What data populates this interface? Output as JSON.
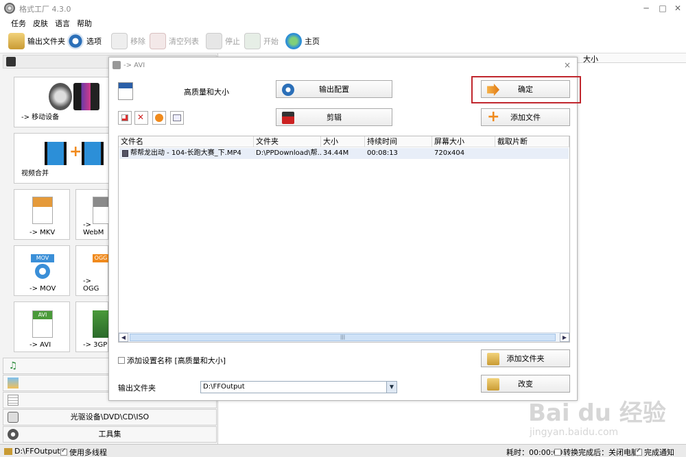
{
  "window": {
    "title": "格式工厂 4.3.0",
    "minimize": "─",
    "maximize": "□",
    "close": "✕"
  },
  "menu": [
    "任务",
    "皮肤",
    "语言",
    "帮助"
  ],
  "toolbar": {
    "output_folder": "输出文件夹",
    "options": "选项",
    "remove": "移除",
    "clear_list": "清空列表",
    "stop": "停止",
    "start": "开始",
    "home": "主页"
  },
  "left_panel": {
    "tiles": {
      "mobile": "-> 移动设备",
      "merge": "视频合并",
      "mkv": "-> MKV",
      "webm": "-> WebM",
      "mov": "-> MOV",
      "ogg": "-> OGG",
      "avi": "-> AVI",
      "3gp": "-> 3GP"
    },
    "icon_badges": {
      "mov": "MOV",
      "ogg": "OGG",
      "avi": "AVI"
    },
    "categories": {
      "disc": "光驱设备\\DVD\\CD\\ISO",
      "tools": "工具集"
    }
  },
  "background_table": {
    "size_header": "大小"
  },
  "dialog": {
    "title": "-> AVI",
    "close": "×",
    "profile_label": "高质量和大小",
    "output_config_button": "输出配置",
    "confirm_button": "确定",
    "edit_button": "剪辑",
    "add_file_button": "添加文件",
    "add_folder_button": "添加文件夹",
    "change_button": "改变",
    "add_setting_name_label": "添加设置名称 [高质量和大小]",
    "output_folder_label": "输出文件夹",
    "output_folder_value": "D:\\FFOutput",
    "columns": [
      "文件名",
      "文件夹",
      "大小",
      "持续时间",
      "屏幕大小",
      "截取片断"
    ],
    "rows": [
      {
        "filename": "帮帮龙出动 - 104-长跑大赛_下.MP4",
        "folder": "D:\\PPDownload\\帮...",
        "size": "34.44M",
        "duration": "00:08:13",
        "screen_size": "720x404",
        "clip": ""
      }
    ],
    "scroll_left": "◀",
    "scroll_right": "▶",
    "scroll_grip": "|||",
    "select_arrow": "▼"
  },
  "statusbar": {
    "folder": "D:\\FFOutput",
    "multithread": "使用多线程",
    "elapsed": "耗时：00:00:00",
    "after_convert": "转换完成后：关闭电脑",
    "notify": "完成通知"
  },
  "watermark": {
    "logo": "Bai du 经验",
    "url": "jingyan.baidu.com"
  },
  "colors": {
    "highlight": "#c0262d",
    "accent_blue": "#1c6fc4",
    "orange_icon": "#f08a1c"
  }
}
